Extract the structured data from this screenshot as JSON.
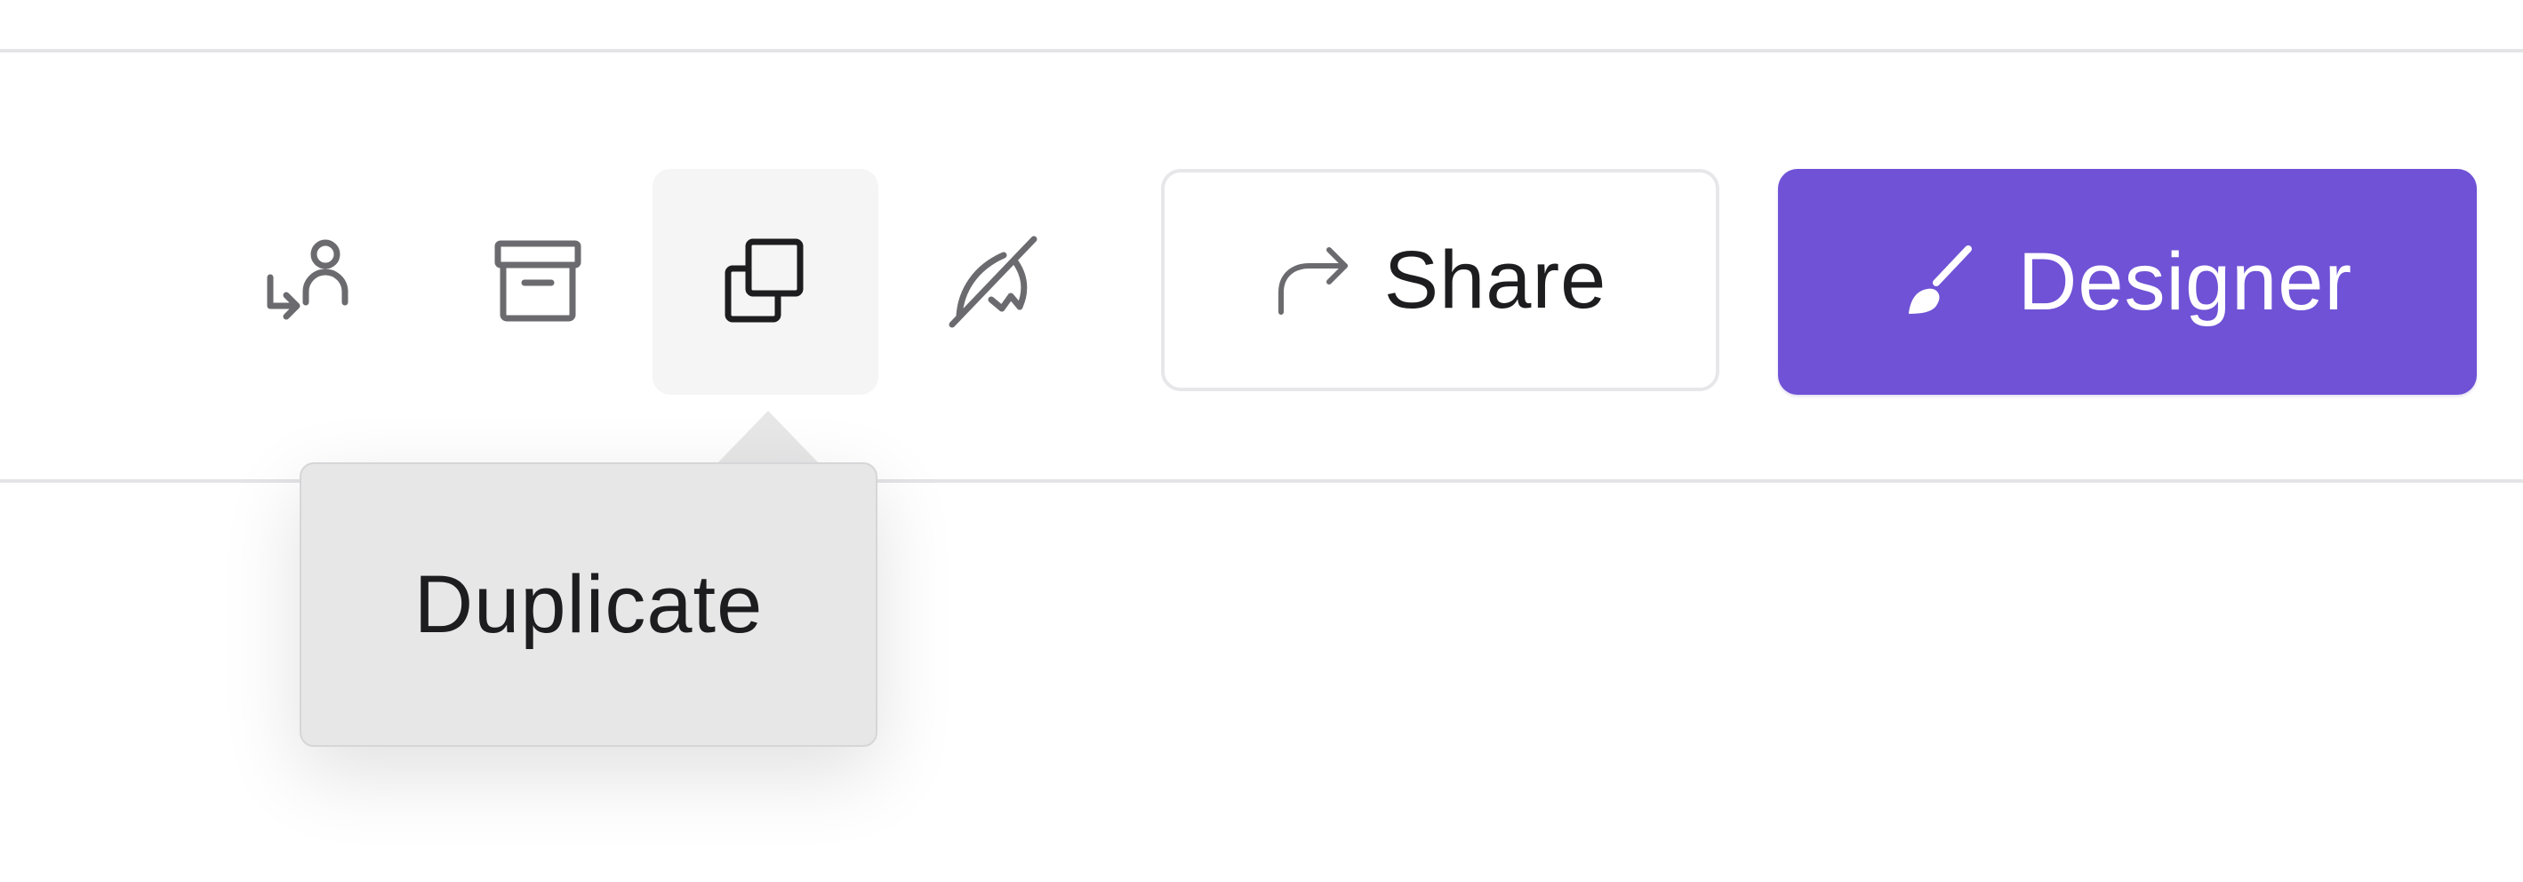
{
  "toolbar": {
    "assign_icon": "user-arrow-icon",
    "archive_icon": "archive-box-icon",
    "duplicate_icon": "duplicate-icon",
    "sign_off_icon": "pen-slash-icon",
    "share_label": "Share",
    "share_icon": "share-arrow-icon",
    "designer_label": "Designer",
    "designer_icon": "paintbrush-icon"
  },
  "tooltip": {
    "text": "Duplicate"
  },
  "colors": {
    "accent": "#6f52d6",
    "divider": "#e4e4e6",
    "tooltip_bg": "#e7e7e8",
    "icon": "#6b6b6f"
  }
}
